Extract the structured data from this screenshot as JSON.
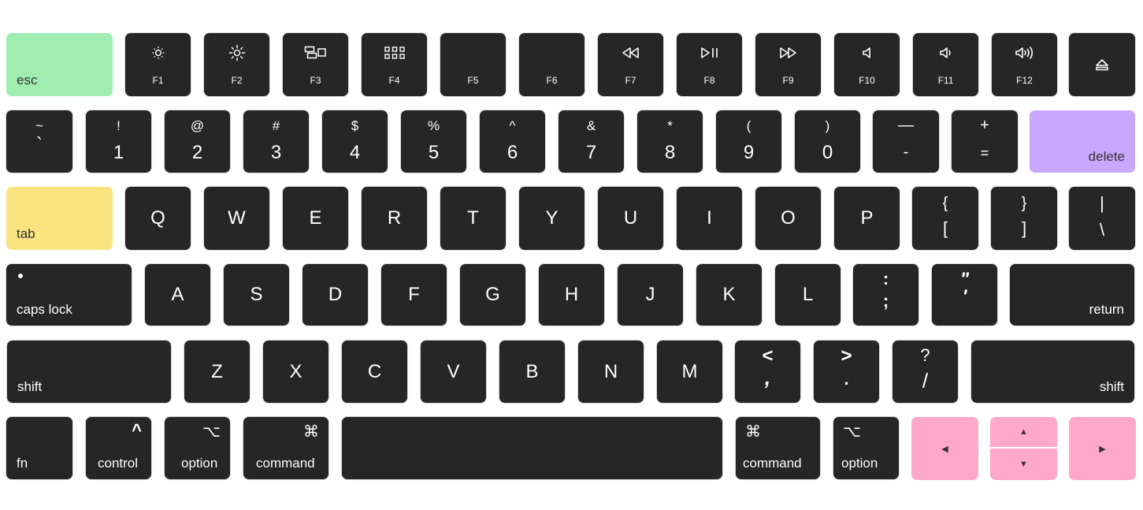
{
  "colors": {
    "key_dark": "#262626",
    "esc": "#9fedb0",
    "delete": "#c9a7fc",
    "tab": "#f9e480",
    "arrows": "#ffa8c8",
    "label_light": "#ffffff",
    "label_dark": "#333333"
  },
  "row_function": {
    "esc": "esc",
    "keys": [
      {
        "label": "F1",
        "icon": "brightness-down-icon"
      },
      {
        "label": "F2",
        "icon": "brightness-up-icon"
      },
      {
        "label": "F3",
        "icon": "mission-control-icon"
      },
      {
        "label": "F4",
        "icon": "launchpad-icon"
      },
      {
        "label": "F5",
        "icon": ""
      },
      {
        "label": "F6",
        "icon": ""
      },
      {
        "label": "F7",
        "icon": "rewind-icon"
      },
      {
        "label": "F8",
        "icon": "play-pause-icon"
      },
      {
        "label": "F9",
        "icon": "fast-forward-icon"
      },
      {
        "label": "F10",
        "icon": "mute-icon"
      },
      {
        "label": "F11",
        "icon": "volume-down-icon"
      },
      {
        "label": "F12",
        "icon": "volume-up-icon"
      }
    ],
    "eject_icon": "eject-icon"
  },
  "row_number": {
    "keys": [
      {
        "top": "~",
        "bottom": "`"
      },
      {
        "top": "!",
        "bottom": "1"
      },
      {
        "top": "@",
        "bottom": "2"
      },
      {
        "top": "#",
        "bottom": "3"
      },
      {
        "top": "$",
        "bottom": "4"
      },
      {
        "top": "%",
        "bottom": "5"
      },
      {
        "top": "^",
        "bottom": "6"
      },
      {
        "top": "&",
        "bottom": "7"
      },
      {
        "top": "*",
        "bottom": "8"
      },
      {
        "top": "(",
        "bottom": "9"
      },
      {
        "top": ")",
        "bottom": "0"
      },
      {
        "top": "—",
        "bottom": "-"
      },
      {
        "top": "+",
        "bottom": "="
      }
    ],
    "delete": "delete"
  },
  "row_qwerty": {
    "tab": "tab",
    "letters": [
      "Q",
      "W",
      "E",
      "R",
      "T",
      "Y",
      "U",
      "I",
      "O",
      "P"
    ],
    "symbols": [
      {
        "top": "{",
        "bottom": "["
      },
      {
        "top": "}",
        "bottom": "]"
      },
      {
        "top": "|",
        "bottom": "\\"
      }
    ]
  },
  "row_home": {
    "caps_lock": "caps lock",
    "letters": [
      "A",
      "S",
      "D",
      "F",
      "G",
      "H",
      "J",
      "K",
      "L"
    ],
    "symbols": [
      {
        "top": ":",
        "bottom": ";"
      },
      {
        "top": "\"",
        "bottom": "'"
      }
    ],
    "return": "return"
  },
  "row_shift": {
    "left_shift": "shift",
    "letters": [
      "Z",
      "X",
      "C",
      "V",
      "B",
      "N",
      "M"
    ],
    "symbols": [
      {
        "top": "<",
        "bottom": ","
      },
      {
        "top": ">",
        "bottom": "."
      },
      {
        "top": "?",
        "bottom": "/"
      }
    ],
    "right_shift": "shift"
  },
  "row_bottom": {
    "fn": "fn",
    "control": {
      "label": "control",
      "symbol": "^"
    },
    "option_left": {
      "label": "option",
      "symbol": "⌥"
    },
    "command_left": {
      "label": "command",
      "symbol": "⌘"
    },
    "space": "",
    "command_right": {
      "label": "command",
      "symbol": "⌘"
    },
    "option_right": {
      "label": "option",
      "symbol": "⌥"
    },
    "arrows": {
      "left": "◀",
      "up": "▲",
      "down": "▼",
      "right": "▶"
    }
  }
}
